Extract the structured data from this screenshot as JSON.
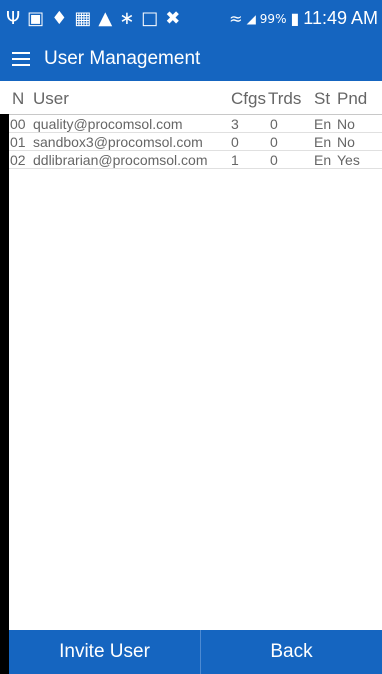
{
  "status_bar": {
    "icons": [
      "usb-icon",
      "image-icon",
      "shield-icon",
      "sim-icon",
      "warning-icon",
      "bluetooth-icon",
      "nfc-icon",
      "mute-icon",
      "wifi-icon",
      "signal-icon",
      "battery-charging-icon"
    ],
    "battery_percent": "99%",
    "time": "11:49 AM"
  },
  "app_bar": {
    "title": "User Management"
  },
  "table": {
    "headers": {
      "n": "N",
      "user": "User",
      "cfgs": "Cfgs",
      "trds": "Trds",
      "st": "St",
      "pnd": "Pnd"
    },
    "rows": [
      {
        "n": "00",
        "user": "quality@procomsol.com",
        "cfgs": "3",
        "trds": "0",
        "st": "En",
        "pnd": "No"
      },
      {
        "n": "01",
        "user": "sandbox3@procomsol.com",
        "cfgs": "0",
        "trds": "0",
        "st": "En",
        "pnd": "No"
      },
      {
        "n": "02",
        "user": "ddlibrarian@procomsol.com",
        "cfgs": "1",
        "trds": "0",
        "st": "En",
        "pnd": "Yes"
      }
    ]
  },
  "bottom_bar": {
    "invite_label": "Invite User",
    "back_label": "Back"
  },
  "colors": {
    "primary": "#1565c0",
    "text": "#666666",
    "background": "#ffffff"
  }
}
